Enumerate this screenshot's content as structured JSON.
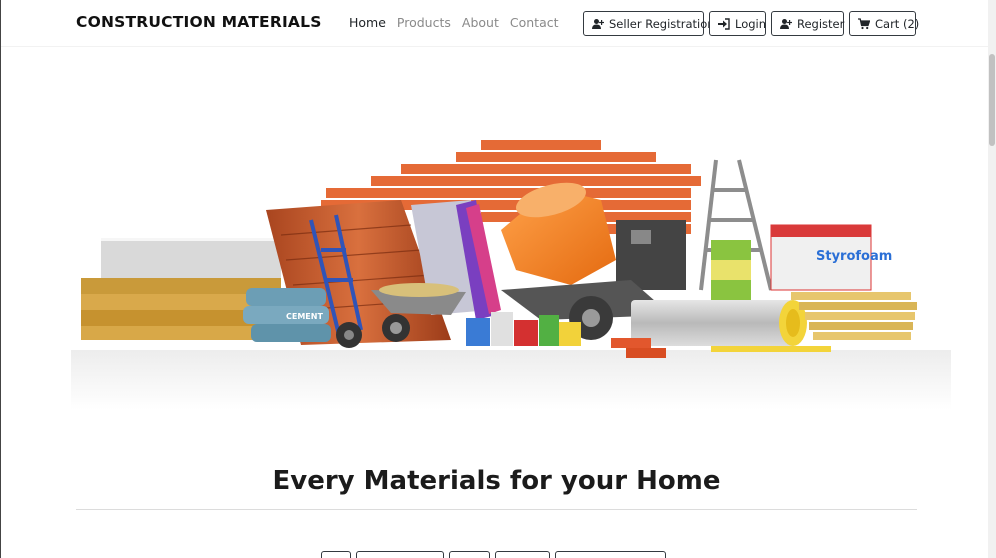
{
  "brand": "CONSTRUCTION MATERIALS",
  "nav": {
    "links": [
      "Home",
      "Products",
      "About",
      "Contact"
    ],
    "active": "Home"
  },
  "buttons": {
    "seller": "Seller Registration",
    "login": "Login",
    "register": "Register",
    "cart": "Cart (2)"
  },
  "hero": {
    "cement_label": "CEMENT",
    "insulation_label": "Styrofoam"
  },
  "headline": "Every Materials for your Home",
  "colors": {
    "brick": "#e56a36",
    "mixer": "#f08022",
    "border": "#343a40"
  }
}
